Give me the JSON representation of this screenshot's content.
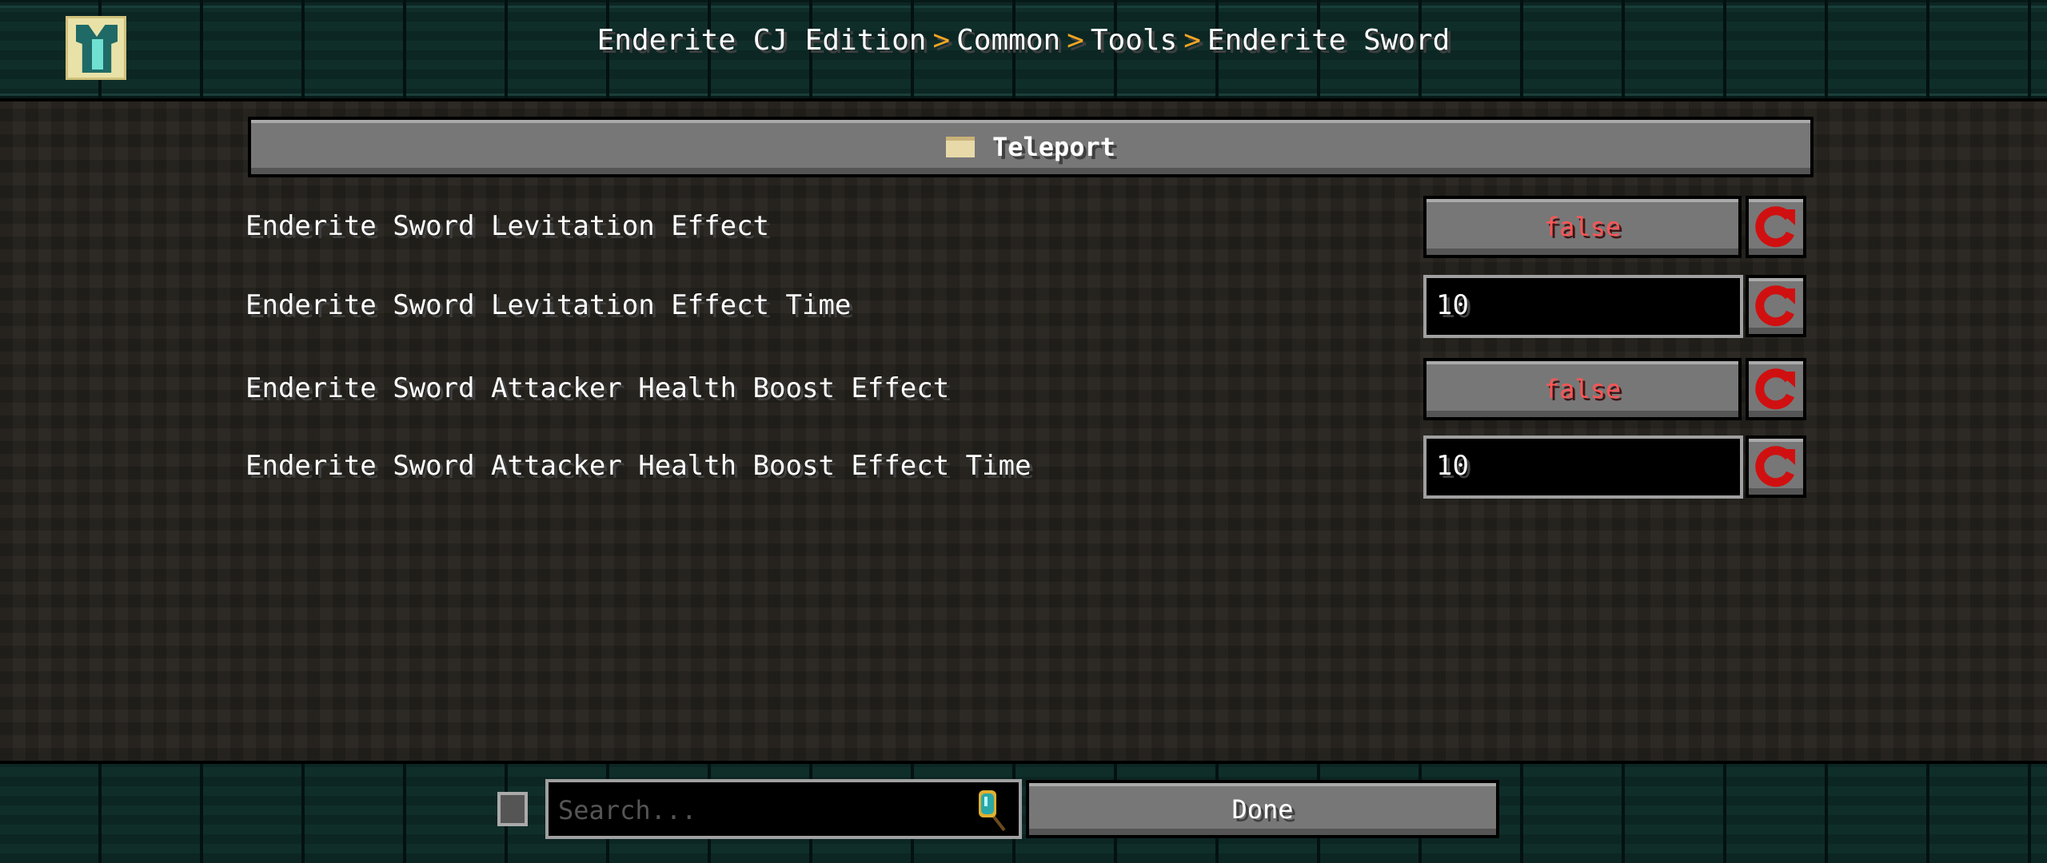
{
  "breadcrumb": [
    "Enderite CJ Edition",
    "Common",
    "Tools",
    "Enderite Sword"
  ],
  "breadcrumb_separator": ">",
  "section": {
    "label": "Teleport",
    "icon": "folder-icon"
  },
  "options": [
    {
      "label": "Enderite Sword Levitation Effect",
      "type": "toggle",
      "value": "false"
    },
    {
      "label": "Enderite Sword Levitation Effect Time",
      "type": "text",
      "value": "10"
    },
    {
      "label": "Enderite Sword Attacker Health Boost Effect",
      "type": "toggle",
      "value": "false"
    },
    {
      "label": "Enderite Sword Attacker Health Boost Effect Time",
      "type": "text",
      "value": "10"
    }
  ],
  "footer": {
    "search_placeholder": "Search...",
    "done_label": "Done"
  },
  "colors": {
    "false_text": "#ff5555",
    "separator": "#f5a623",
    "reset_icon": "#d01010"
  }
}
